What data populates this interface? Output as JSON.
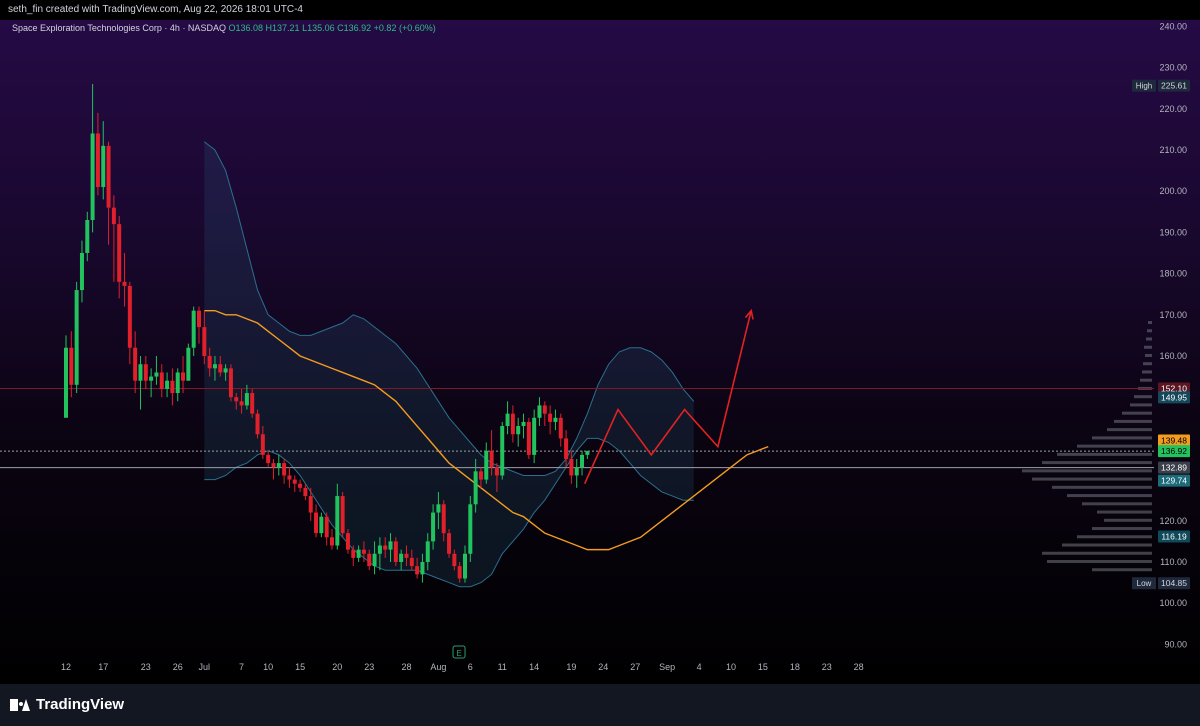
{
  "header": {
    "attribution": "seth_fin created with TradingView.com, Aug 22, 2026 18:01 UTC-4"
  },
  "legend": {
    "symbol": "Space Exploration Technologies Corp · 4h · NASDAQ",
    "open": "O136.08",
    "high": "H137.21",
    "low": "L135.06",
    "close": "C136.92",
    "change": "+0.82 (+0.60%)"
  },
  "footer": {
    "brand": "TradingView"
  },
  "earnings_marker": "E",
  "colors": {
    "up": "#22c35e",
    "down": "#e0202a",
    "ma": "#f39c20",
    "band": "#2a6f8f",
    "projection": "#e22222"
  },
  "chart_data": {
    "type": "candlestick",
    "title": "",
    "interval": "4h",
    "ylim": [
      85,
      243
    ],
    "y_ticks": [
      90,
      100,
      110,
      120,
      130,
      140,
      150,
      160,
      170,
      180,
      190,
      200,
      210,
      220,
      230,
      240
    ],
    "y_tick_labels": [
      "90.00",
      "100.00",
      "110.00",
      "120.00",
      "130.00",
      "140.00",
      "150.00",
      "160.00",
      "170.00",
      "180.00",
      "190.00",
      "200.00",
      "210.00",
      "220.00",
      "230.00",
      "240.00"
    ],
    "x_ticks": [
      "12",
      "17",
      "23",
      "26",
      "Jul",
      "7",
      "10",
      "15",
      "20",
      "23",
      "28",
      "Aug",
      "6",
      "11",
      "14",
      "19",
      "24",
      "27",
      "Sep",
      "4",
      "10",
      "15",
      "18",
      "23",
      "28"
    ],
    "x_tick_index": [
      0,
      7,
      15,
      21,
      26,
      33,
      38,
      44,
      51,
      57,
      64,
      70,
      76,
      82,
      88,
      95,
      101,
      107,
      113,
      119,
      125,
      131,
      137,
      143,
      149
    ],
    "candles": [
      [
        145,
        165,
        148,
        162
      ],
      [
        162,
        166,
        150,
        153
      ],
      [
        153,
        178,
        151,
        176
      ],
      [
        176,
        188,
        173,
        185
      ],
      [
        185,
        195,
        183,
        193
      ],
      [
        193,
        226,
        190,
        214
      ],
      [
        214,
        219,
        199,
        201
      ],
      [
        201,
        217,
        198,
        211
      ],
      [
        211,
        212,
        187,
        196
      ],
      [
        196,
        199,
        178,
        192
      ],
      [
        192,
        194,
        174,
        178
      ],
      [
        178,
        185,
        172,
        177
      ],
      [
        177,
        178,
        158,
        162
      ],
      [
        162,
        166,
        151,
        154
      ],
      [
        154,
        160,
        147,
        158
      ],
      [
        158,
        160,
        152,
        154
      ],
      [
        154,
        157,
        150,
        155
      ],
      [
        155,
        160,
        153,
        156
      ],
      [
        156,
        158,
        150,
        152
      ],
      [
        152,
        156,
        150,
        154
      ],
      [
        154,
        157,
        148,
        151
      ],
      [
        151,
        157,
        149,
        156
      ],
      [
        156,
        160,
        151,
        154
      ],
      [
        154,
        163,
        154,
        162
      ],
      [
        162,
        172,
        160,
        171
      ],
      [
        171,
        172,
        163,
        167
      ],
      [
        167,
        171,
        158,
        160
      ],
      [
        160,
        162,
        155,
        157
      ],
      [
        157,
        160,
        154,
        158
      ],
      [
        158,
        160,
        155,
        156
      ],
      [
        156,
        158,
        154,
        157
      ],
      [
        157,
        158,
        149,
        150
      ],
      [
        150,
        151,
        147,
        149
      ],
      [
        149,
        152,
        146,
        148
      ],
      [
        148,
        153,
        147,
        151
      ],
      [
        151,
        152,
        145,
        146
      ],
      [
        146,
        147,
        140,
        141
      ],
      [
        141,
        143,
        135,
        136
      ],
      [
        136,
        137,
        133,
        134
      ],
      [
        134,
        135,
        130,
        133
      ],
      [
        133,
        136,
        131,
        134
      ],
      [
        134,
        135,
        129,
        131
      ],
      [
        131,
        133,
        128,
        130
      ],
      [
        130,
        131,
        127,
        129
      ],
      [
        129,
        130,
        127,
        128
      ],
      [
        128,
        129,
        125,
        126
      ],
      [
        126,
        128,
        120,
        122
      ],
      [
        122,
        124,
        116,
        117
      ],
      [
        117,
        122,
        116,
        121
      ],
      [
        121,
        122,
        114,
        116
      ],
      [
        116,
        118,
        113,
        114
      ],
      [
        114,
        129,
        113,
        126
      ],
      [
        126,
        127,
        116,
        117
      ],
      [
        117,
        118,
        112,
        113
      ],
      [
        113,
        114,
        109,
        111
      ],
      [
        111,
        114,
        110,
        113
      ],
      [
        113,
        115,
        110,
        112
      ],
      [
        112,
        113,
        108,
        109
      ],
      [
        109,
        115,
        107,
        112
      ],
      [
        112,
        116,
        108,
        114
      ],
      [
        114,
        116,
        111,
        113
      ],
      [
        113,
        117,
        110,
        115
      ],
      [
        115,
        116,
        109,
        110
      ],
      [
        110,
        113,
        108,
        112
      ],
      [
        112,
        114,
        109,
        111
      ],
      [
        111,
        113,
        108,
        109
      ],
      [
        109,
        111,
        106,
        107
      ],
      [
        107,
        112,
        105,
        110
      ],
      [
        110,
        117,
        108,
        115
      ],
      [
        115,
        124,
        113,
        122
      ],
      [
        122,
        127,
        118,
        124
      ],
      [
        124,
        125,
        115,
        117
      ],
      [
        117,
        118,
        111,
        112
      ],
      [
        112,
        113,
        108,
        109
      ],
      [
        109,
        110,
        105,
        106
      ],
      [
        106,
        114,
        105,
        112
      ],
      [
        112,
        126,
        110,
        124
      ],
      [
        124,
        135,
        122,
        132
      ],
      [
        132,
        133,
        128,
        130
      ],
      [
        130,
        139,
        129,
        137
      ],
      [
        137,
        142,
        131,
        133
      ],
      [
        133,
        134,
        127,
        131
      ],
      [
        131,
        144,
        130,
        143
      ],
      [
        143,
        149,
        141,
        146
      ],
      [
        146,
        148,
        139,
        141
      ],
      [
        141,
        145,
        138,
        143
      ],
      [
        143,
        146,
        140,
        144
      ],
      [
        144,
        145,
        135,
        136
      ],
      [
        136,
        147,
        134,
        145
      ],
      [
        145,
        150,
        143,
        148
      ],
      [
        148,
        149,
        143,
        146
      ],
      [
        146,
        148,
        141,
        144
      ],
      [
        144,
        147,
        142,
        145
      ],
      [
        145,
        146,
        138,
        140
      ],
      [
        140,
        142,
        133,
        135
      ],
      [
        135,
        137,
        129,
        131
      ],
      [
        131,
        135,
        128,
        133
      ],
      [
        133,
        137,
        131,
        136
      ],
      [
        136,
        137,
        135,
        136.92
      ]
    ],
    "series": [
      {
        "name": "",
        "values": [
          171,
          171,
          170,
          170,
          169,
          168,
          166,
          164,
          162,
          160,
          159,
          158,
          157,
          156,
          155,
          154,
          153,
          151,
          149,
          146,
          143,
          140,
          137,
          134,
          132,
          130,
          128,
          126,
          124,
          122,
          121,
          119,
          117,
          116,
          115,
          114,
          113,
          113,
          113,
          114,
          115,
          116,
          118,
          120,
          122,
          124,
          126,
          128,
          130,
          132,
          134,
          136,
          137,
          138
        ]
      }
    ],
    "band_upper": [
      212,
      210,
      205,
      196,
      186,
      176,
      170,
      168,
      166,
      165,
      165,
      166,
      167,
      168,
      170,
      169,
      167,
      165,
      163,
      160,
      157,
      153,
      149,
      145,
      142,
      139,
      136,
      134,
      133,
      132,
      131,
      131,
      131,
      132,
      135,
      140,
      146,
      153,
      158,
      161,
      162,
      162,
      161,
      159,
      156,
      152,
      149
    ],
    "band_lower": [
      130,
      130,
      131,
      133,
      134,
      136,
      137,
      136,
      134,
      131,
      127,
      123,
      119,
      116,
      113,
      111,
      109,
      108,
      108,
      108,
      108,
      107,
      106,
      105,
      104,
      104,
      105,
      107,
      112,
      115,
      118,
      122,
      125,
      129,
      133,
      137,
      140,
      140,
      139,
      137,
      134,
      131,
      129,
      127,
      126,
      125,
      125
    ],
    "levels": [
      {
        "label": "High",
        "value": 225.61
      },
      {
        "label": "",
        "value": 152.1
      },
      {
        "label": "",
        "value": 149.95
      },
      {
        "label": "",
        "value": 139.48
      },
      {
        "label": "",
        "value": 136.92
      },
      {
        "label": "",
        "value": 132.89
      },
      {
        "label": "",
        "value": 129.74
      },
      {
        "label": "",
        "value": 116.19
      },
      {
        "label": "Low",
        "value": 104.85
      }
    ],
    "horizontal_lines": [
      152.1,
      136.92,
      132.89
    ],
    "projection_path": [
      [
        0,
        129
      ],
      [
        6,
        147
      ],
      [
        12,
        136
      ],
      [
        18,
        147
      ],
      [
        24,
        138
      ],
      [
        30,
        171
      ]
    ],
    "volume_profile": [
      [
        168,
        4
      ],
      [
        166,
        5
      ],
      [
        164,
        6
      ],
      [
        162,
        8
      ],
      [
        160,
        7
      ],
      [
        158,
        9
      ],
      [
        156,
        10
      ],
      [
        154,
        12
      ],
      [
        152,
        14
      ],
      [
        150,
        18
      ],
      [
        148,
        22
      ],
      [
        146,
        30
      ],
      [
        144,
        38
      ],
      [
        142,
        45
      ],
      [
        140,
        60
      ],
      [
        138,
        75
      ],
      [
        136,
        95
      ],
      [
        134,
        110
      ],
      [
        132,
        130
      ],
      [
        130,
        120
      ],
      [
        128,
        100
      ],
      [
        126,
        85
      ],
      [
        124,
        70
      ],
      [
        122,
        55
      ],
      [
        120,
        48
      ],
      [
        118,
        60
      ],
      [
        116,
        75
      ],
      [
        114,
        90
      ],
      [
        112,
        110
      ],
      [
        110,
        105
      ],
      [
        108,
        60
      ]
    ]
  }
}
